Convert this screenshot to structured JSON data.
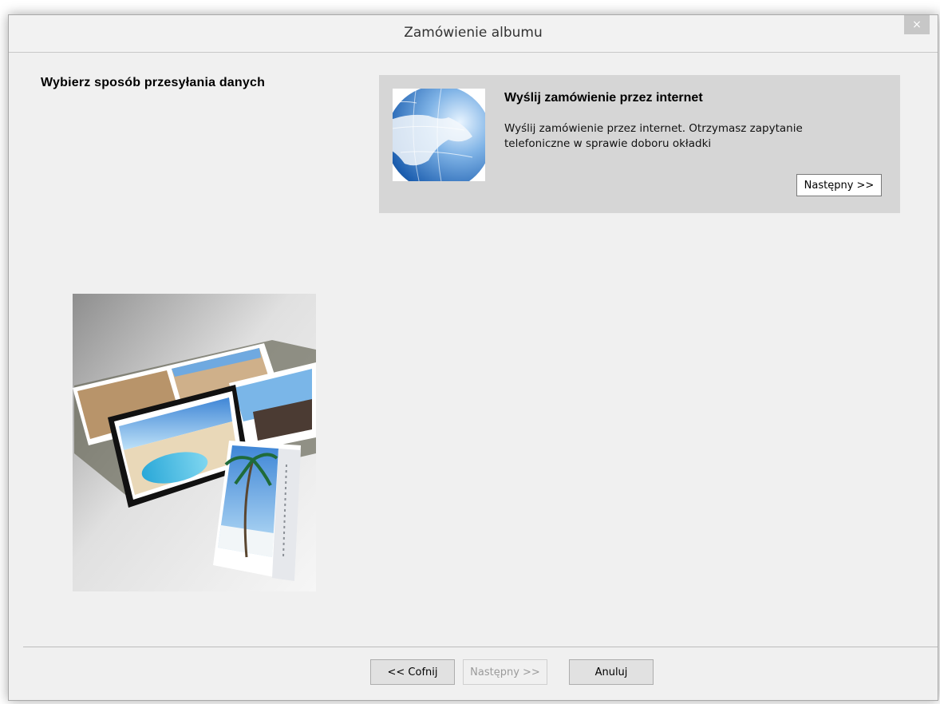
{
  "window": {
    "title": "Zamówienie albumu",
    "close_icon": "×"
  },
  "main": {
    "heading": "Wybierz sposób przesyłania danych"
  },
  "option": {
    "icon": "globe-icon",
    "title": "Wyślij zamówienie przez internet",
    "description": "Wyślij zamówienie przez internet. Otrzymasz zapytanie telefoniczne w sprawie doboru okładki",
    "next_label": "Następny >>"
  },
  "illustration": {
    "icon": "photo-album-image"
  },
  "footer": {
    "back_label": "<< Cofnij",
    "next_label": "Następny >>",
    "next_enabled": false,
    "cancel_label": "Anuluj"
  }
}
